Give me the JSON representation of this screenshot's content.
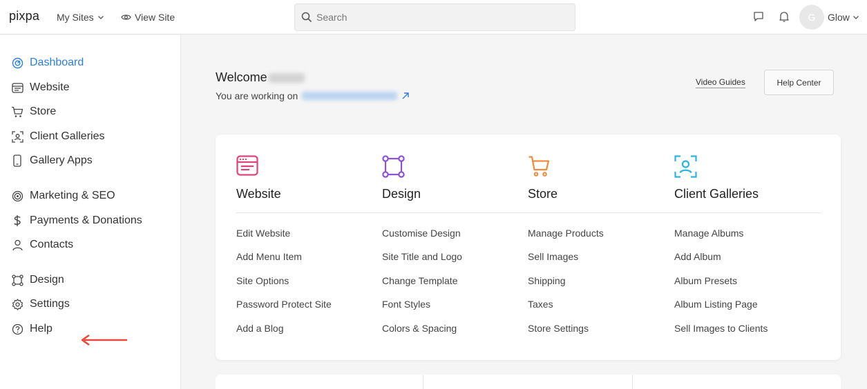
{
  "topbar": {
    "logo": "pixpa",
    "my_sites": "My Sites",
    "view_site": "View Site",
    "search_placeholder": "Search",
    "avatar_initial": "G",
    "user_name": "Glow"
  },
  "sidebar": {
    "items": [
      {
        "label": "Dashboard",
        "icon": "dashboard-icon",
        "active": true
      },
      {
        "label": "Website",
        "icon": "website-icon"
      },
      {
        "label": "Store",
        "icon": "cart-icon"
      },
      {
        "label": "Client Galleries",
        "icon": "client-galleries-icon"
      },
      {
        "label": "Gallery Apps",
        "icon": "phone-icon"
      },
      {
        "label": "Marketing & SEO",
        "icon": "target-icon"
      },
      {
        "label": "Payments & Donations",
        "icon": "dollar-icon"
      },
      {
        "label": "Contacts",
        "icon": "person-icon"
      },
      {
        "label": "Design",
        "icon": "design-icon"
      },
      {
        "label": "Settings",
        "icon": "gear-icon"
      },
      {
        "label": "Help",
        "icon": "help-icon"
      }
    ]
  },
  "main": {
    "welcome": "Welcome",
    "working_on": "You are working on",
    "video_guides": "Video Guides",
    "help_center": "Help Center",
    "columns": [
      {
        "title": "Website",
        "icon": "website-icon",
        "color": "#e0427a",
        "links": [
          "Edit Website",
          "Add Menu Item",
          "Site Options",
          "Password Protect Site",
          "Add a Blog"
        ]
      },
      {
        "title": "Design",
        "icon": "design-icon",
        "color": "#8e52d6",
        "links": [
          "Customise Design",
          "Site Title and Logo",
          "Change Template",
          "Font Styles",
          "Colors & Spacing"
        ]
      },
      {
        "title": "Store",
        "icon": "cart-icon",
        "color": "#f08a3c",
        "links": [
          "Manage Products",
          "Sell Images",
          "Shipping",
          "Taxes",
          "Store Settings"
        ]
      },
      {
        "title": "Client Galleries",
        "icon": "client-galleries-icon",
        "color": "#2ab4e0",
        "links": [
          "Manage Albums",
          "Add Album",
          "Album Presets",
          "Album Listing Page",
          "Sell Images to Clients"
        ]
      }
    ]
  },
  "colors": {
    "accent": "#2b7fdb",
    "arrow": "#e8483b"
  }
}
